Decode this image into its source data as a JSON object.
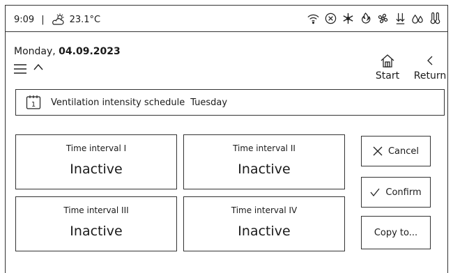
{
  "status": {
    "time": "9:09",
    "separator": "|",
    "weather_icon": "partly-sunny-icon",
    "temperature": "23.1°C",
    "icons": [
      "wifi-icon",
      "alarm-off-icon",
      "snowflake-icon",
      "heating-icon",
      "fan-icon",
      "airflow-icon",
      "humidity-icon",
      "thermometer-icon"
    ]
  },
  "header": {
    "date_prefix": "Monday, ",
    "date": "04.09.2023",
    "start_label": "Start",
    "return_label": "Return"
  },
  "schedule": {
    "calendar_day": "1",
    "title": "Ventilation intensity schedule",
    "day": "Tuesday"
  },
  "intervals": [
    {
      "label": "Time interval I",
      "state": "Inactive"
    },
    {
      "label": "Time interval II",
      "state": "Inactive"
    },
    {
      "label": "Time interval III",
      "state": "Inactive"
    },
    {
      "label": "Time interval IV",
      "state": "Inactive"
    }
  ],
  "actions": {
    "cancel": "Cancel",
    "confirm": "Confirm",
    "copy": "Copy to..."
  }
}
